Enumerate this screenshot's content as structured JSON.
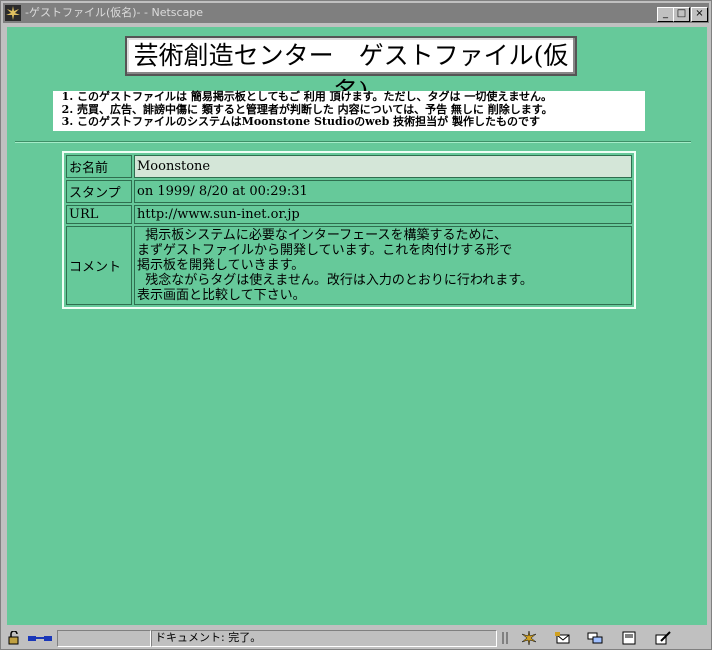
{
  "window": {
    "title": "-ゲストファイル(仮名)- - Netscape",
    "buttons": {
      "minimize": "_",
      "maximize": "□",
      "close": "×"
    }
  },
  "page": {
    "heading": "芸術創造センター　ゲストファイル(仮名)",
    "rules": [
      "このゲストファイルは 簡易掲示板としてもご 利用 頂けます。ただし、タグは 一切使えません。",
      "売買、広告、誹謗中傷に 類すると管理者が判断した 内容については、予告 無しに 削除します。",
      "このゲストファイルのシステムはMoonstone Studioのweb 技術担当が 製作したものです"
    ],
    "entry": {
      "name_label": "お名前",
      "name_value": "Moonstone",
      "stamp_label": "スタンプ",
      "stamp_value": "on 1999/ 8/20 at 00:29:31",
      "url_label": "URL",
      "url_value": "http://www.sun-inet.or.jp",
      "comment_label": "コメント",
      "comment_value": "  掲示板システムに必要なインターフェースを構築するために、\nまずゲストファイルから開発しています。これを肉付けする形で\n掲示板を開発していきます。\n  残念ながらタグは使えません。改行は入力のとおりに行われます。\n表示画面と比較して下さい。"
    }
  },
  "statusbar": {
    "text": "ドキュメント: 完了。",
    "icons": [
      "lock-icon",
      "connection-icon",
      "component-bar-icon",
      "navigator-icon",
      "mailbox-icon",
      "discussion-icon",
      "address-book-icon",
      "composer-icon"
    ]
  },
  "colors": {
    "background": "#66c99a",
    "link": "#1a37b8",
    "name_cell_bg": "#d4e6d8"
  }
}
